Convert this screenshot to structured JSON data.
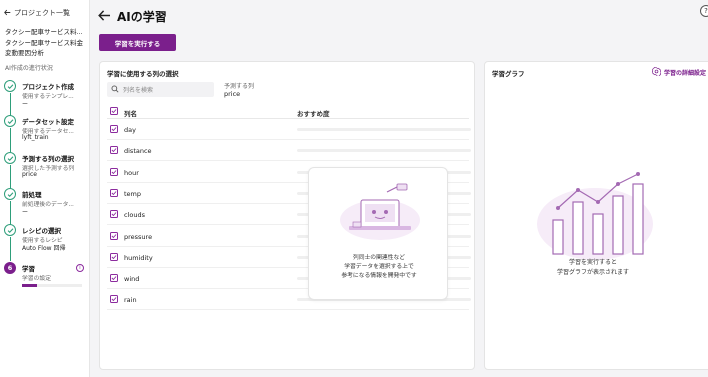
{
  "sidebar": {
    "back_label": "プロジェクト一覧",
    "project_lines": [
      "タクシー配車サービス料...",
      "タクシー配車サービス料金",
      "変動要因分析"
    ],
    "section_label": "AI作成の進行状況",
    "steps": [
      {
        "title": "プロジェクト作成",
        "sub": "使用するテンプレ...",
        "val": "ー"
      },
      {
        "title": "データセット設定",
        "sub": "使用するデータセ...",
        "val": "lyft_train"
      },
      {
        "title": "予測する列の選択",
        "sub": "選択した予測する列",
        "val": "price"
      },
      {
        "title": "前処理",
        "sub": "前処理後のデータ...",
        "val": "ー"
      },
      {
        "title": "レシピの選択",
        "sub": "使用するレシピ",
        "val": "Auto Flow 回帰"
      }
    ],
    "active_step": {
      "number": "6",
      "title": "学習",
      "sub": "学習の設定",
      "progress": 0.25
    }
  },
  "header": {
    "title": "AIの学習",
    "help": "?"
  },
  "train_button": "学習を実行する",
  "columns_panel": {
    "title": "学習に使用する列の選択",
    "search_placeholder": "列名を検索",
    "predict_label": "予測する列",
    "predict_value": "price",
    "col_name_header": "列名",
    "col_reco_header": "おすすめ度",
    "rows": [
      "day",
      "distance",
      "hour",
      "temp",
      "clouds",
      "pressure",
      "humidity",
      "wind",
      "rain"
    ],
    "empty_lines": [
      "列同士の関連性など",
      "学習データを選択する上で",
      "参考になる情報を開発中です"
    ]
  },
  "graph_panel": {
    "title": "学習グラフ",
    "settings_label": "学習の詳細設定",
    "empty_lines": [
      "学習を実行すると",
      "学習グラフが表示されます"
    ]
  },
  "colors": {
    "accent": "#7b1f8c",
    "done": "#2e9e7a"
  }
}
